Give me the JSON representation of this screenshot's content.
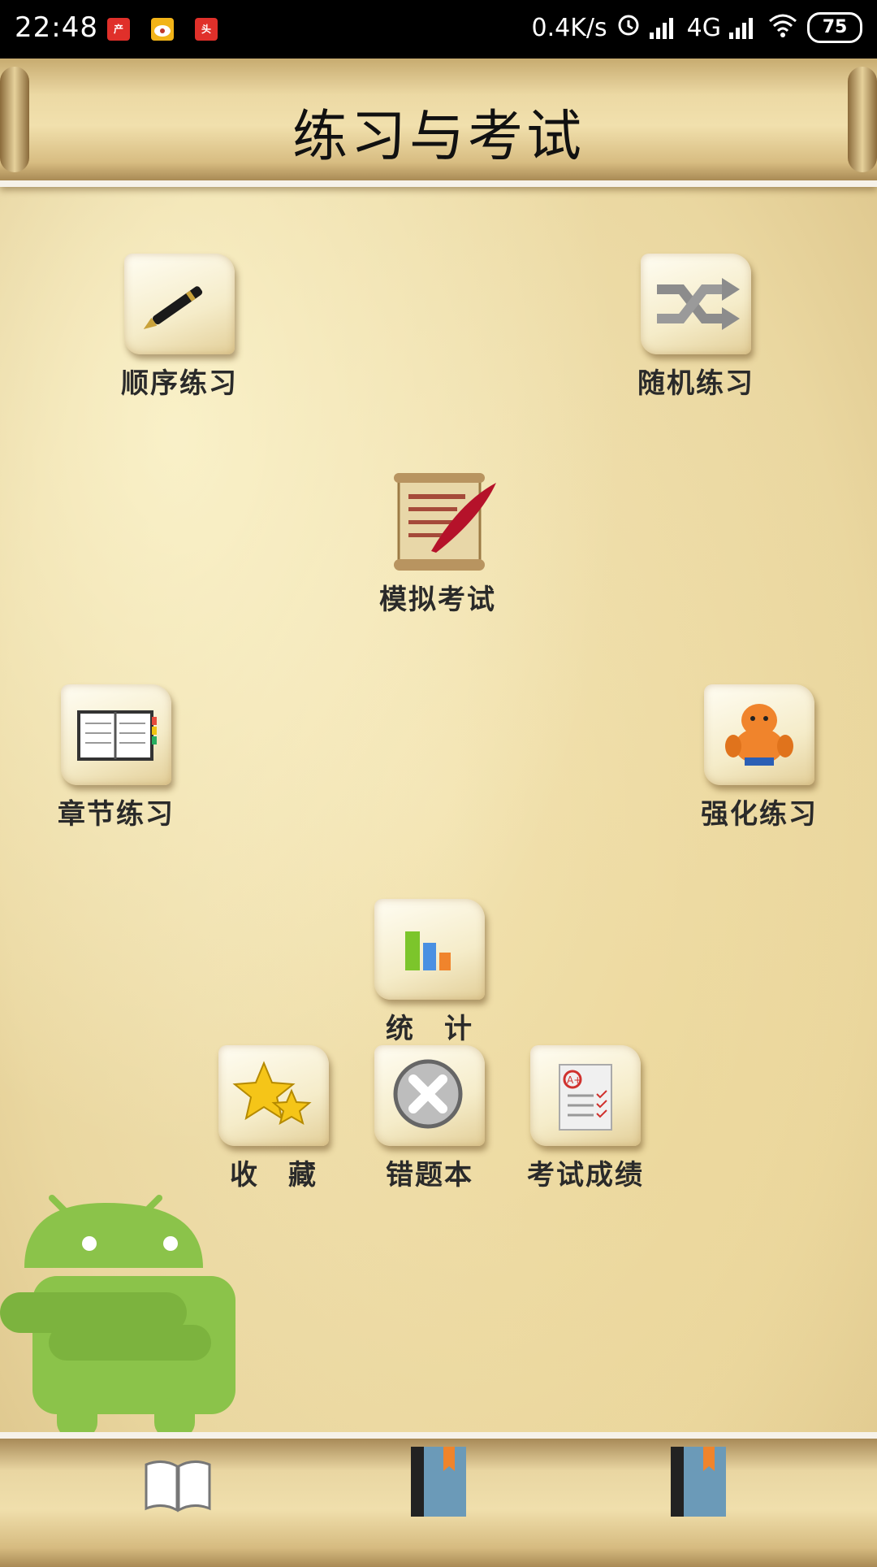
{
  "status_bar": {
    "time": "22:48",
    "net_speed": "0.4K/s",
    "network": "4G",
    "battery": "75",
    "app_icons": [
      "news-app-icon",
      "weibo-icon",
      "toutiao-icon"
    ]
  },
  "header": {
    "title": "练习与考试"
  },
  "menu": {
    "sequential": "顺序练习",
    "random": "随机练习",
    "mock_exam": "模拟考试",
    "chapter": "章节练习",
    "intensive": "强化练习",
    "statistics": "统　计",
    "favorites": "收　藏",
    "wrong_book": "错题本",
    "exam_scores": "考试成绩"
  },
  "colors": {
    "parchment": "#ead7a0",
    "text": "#2a2a2a",
    "android_green": "#8bc34a",
    "bookmark_orange": "#f0842c",
    "book_blue": "#6b9ab8"
  },
  "bottom_nav": [
    "open-book-icon",
    "bookmark-book-icon",
    "bookmark-book-icon"
  ]
}
